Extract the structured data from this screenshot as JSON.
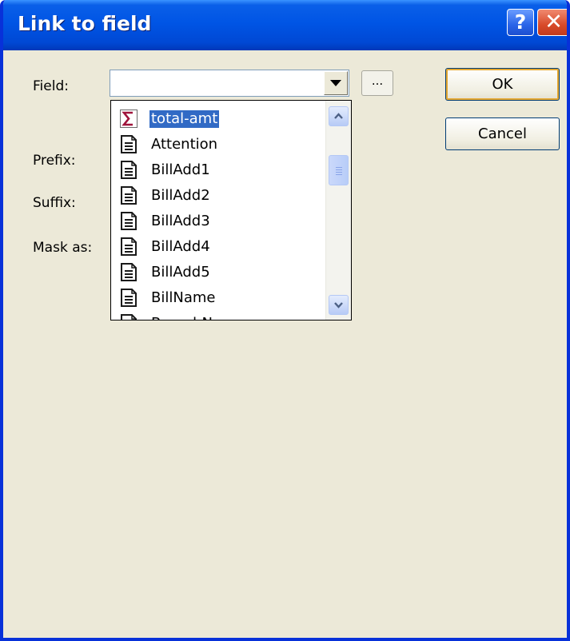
{
  "window": {
    "title": "Link to field",
    "help_glyph": "?",
    "close_glyph": "✕"
  },
  "form": {
    "field_label": "Field:",
    "field_value": "",
    "browse_label": "...",
    "prefix_label": "Prefix:",
    "suffix_label": "Suffix:",
    "mask_label": "Mask as:"
  },
  "buttons": {
    "ok_label": "OK",
    "cancel_label": "Cancel"
  },
  "dropdown": {
    "items": [
      {
        "label": "total-amt",
        "icon": "sigma-icon",
        "selected": true
      },
      {
        "label": "Attention",
        "icon": "document-field-icon",
        "selected": false
      },
      {
        "label": "BillAdd1",
        "icon": "document-field-icon",
        "selected": false
      },
      {
        "label": "BillAdd2",
        "icon": "document-field-icon",
        "selected": false
      },
      {
        "label": "BillAdd3",
        "icon": "document-field-icon",
        "selected": false
      },
      {
        "label": "BillAdd4",
        "icon": "document-field-icon",
        "selected": false
      },
      {
        "label": "BillAdd5",
        "icon": "document-field-icon",
        "selected": false
      },
      {
        "label": "BillName",
        "icon": "document-field-icon",
        "selected": false
      },
      {
        "label": "BranchName",
        "icon": "document-field-icon",
        "selected": false
      }
    ],
    "scroll_fraction": 0.25
  },
  "colors": {
    "titlebar": "#0055e5",
    "window_bg": "#ece9d8",
    "selection": "#316ac5",
    "sigma": "#a0143c"
  }
}
